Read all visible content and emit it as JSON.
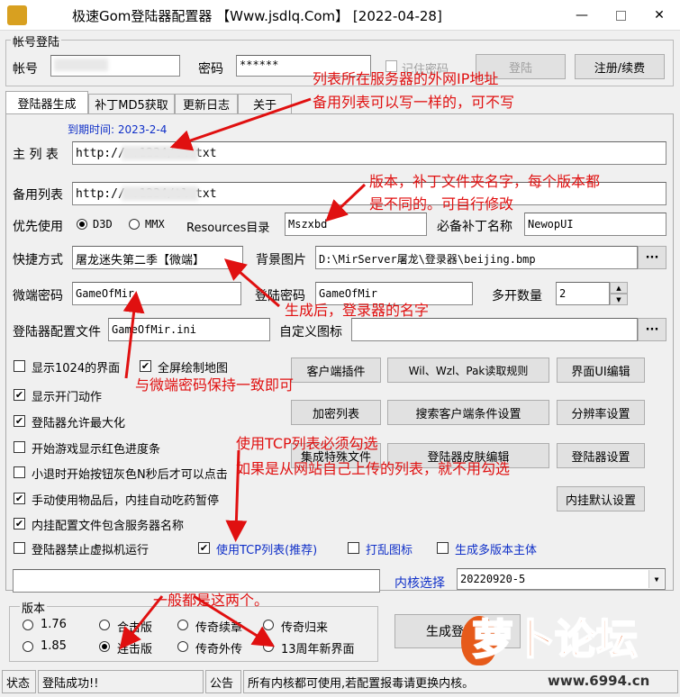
{
  "window": {
    "title": "极速Gom登陆器配置器 【Www.jsdlq.Com】 [2022-04-28]",
    "min": "—",
    "max": "☐",
    "close": "✕"
  },
  "login": {
    "group_label": "帐号登陆",
    "account_label": "帐号",
    "password_label": "密码",
    "password_value": "******",
    "remember_label": "记住密码",
    "login_button": "登陆",
    "register_button": "注册/续费"
  },
  "tabs": [
    "登陆器生成",
    "补丁MD5获取",
    "更新日志",
    "关于"
  ],
  "expire_label": "到期时间: 2023-2-4",
  "form": {
    "main_list_label": "主 列 表",
    "main_list_value": "http://              :1234/tl.txt",
    "backup_list_label": "备用列表",
    "backup_list_value": "http://              :1234/tl.txt",
    "priority_label": "优先使用",
    "d3d_label": "D3D",
    "mmx_label": "MMX",
    "resources_label": "Resources目录",
    "resources_value": "Mszxbd",
    "patch_label": "必备补丁名称",
    "patch_value": "NewopUI",
    "shortcut_label": "快捷方式",
    "shortcut_value": "屠龙迷失第二季【微端】",
    "bg_label": "背景图片",
    "bg_value": "D:\\MirServer屠龙\\登录器\\beijing.bmp",
    "browse": "···",
    "micro_pwd_label": "微端密码",
    "micro_pwd_value": "GameOfMir",
    "login_pwd_label": "登陆密码",
    "login_pwd_value": "GameOfMir",
    "multi_label": "多开数量",
    "multi_value": "2",
    "config_label": "登陆器配置文件",
    "config_value": "GameOfMir.ini",
    "icon_label": "自定义图标",
    "icon_value": "",
    "icon_browse": "···"
  },
  "checks": [
    {
      "label": "显示1024的界面",
      "checked": false
    },
    {
      "label": "全屏绘制地图",
      "checked": true
    },
    {
      "label": "显示开门动作",
      "checked": true
    },
    {
      "label": "登陆器允许最大化",
      "checked": true
    },
    {
      "label": "开始游戏显示红色进度条",
      "checked": false
    },
    {
      "label": "小退时开始按钮灰色N秒后才可以点击",
      "checked": false
    },
    {
      "label": "手动使用物品后，内挂自动吃药暂停",
      "checked": true
    },
    {
      "label": "内挂配置文件包含服务器名称",
      "checked": true
    },
    {
      "label": "登陆器禁止虚拟机运行",
      "checked": false
    },
    {
      "label": "使用TCP列表(推荐)",
      "checked": true
    },
    {
      "label": "打乱图标",
      "checked": false
    },
    {
      "label": "生成多版本主体",
      "checked": false
    }
  ],
  "buttons": {
    "client_plugin": "客户端插件",
    "wil_rule": "Wil、Wzl、Pak读取规则",
    "ui_edit": "界面UI编辑",
    "encrypt_list": "加密列表",
    "search_client": "搜索客户端条件设置",
    "resolution": "分辨率设置",
    "special_file": "集成特殊文件",
    "skin_edit": "登陆器皮肤编辑",
    "launcher_settings": "登陆器设置",
    "plugin_default": "内挂默认设置",
    "generate": "生成登陆器"
  },
  "kernel": {
    "label": "内核选择",
    "value": "20220920-5"
  },
  "version": {
    "group_label": "版本",
    "options": [
      "1.76",
      "合击版",
      "传奇续章",
      "传奇归来",
      "1.85",
      "连击版",
      "传奇外传",
      "13周年新界面"
    ],
    "selected": [
      false,
      false,
      false,
      false,
      false,
      true,
      false,
      false
    ]
  },
  "status": {
    "label": "状态",
    "text": "登陆成功!!",
    "notice_label": "公告",
    "notice_text": "所有内核都可使用,若配置报毒请更换内核。"
  },
  "annotations": {
    "a1": "列表所在服务器的外网IP地址",
    "a2": "备用列表可以写一样的，可不写",
    "a3": "版本，补丁文件夹名字，每个版本都",
    "a4": "是不同的。可自行修改",
    "a5": "生成后，登录器的名字",
    "a6": "与微端密码保持一致即可",
    "a7": "使用TCP列表必须勾选",
    "a8": "如果是从网站自己上传的列表，就不用勾选",
    "a9": "一般都是这两个。"
  },
  "watermark": {
    "text": "萝卜论坛",
    "url": "www.6994.cn"
  },
  "colors": {
    "annotation": "#e01010",
    "link_blue": "#1030c8"
  }
}
